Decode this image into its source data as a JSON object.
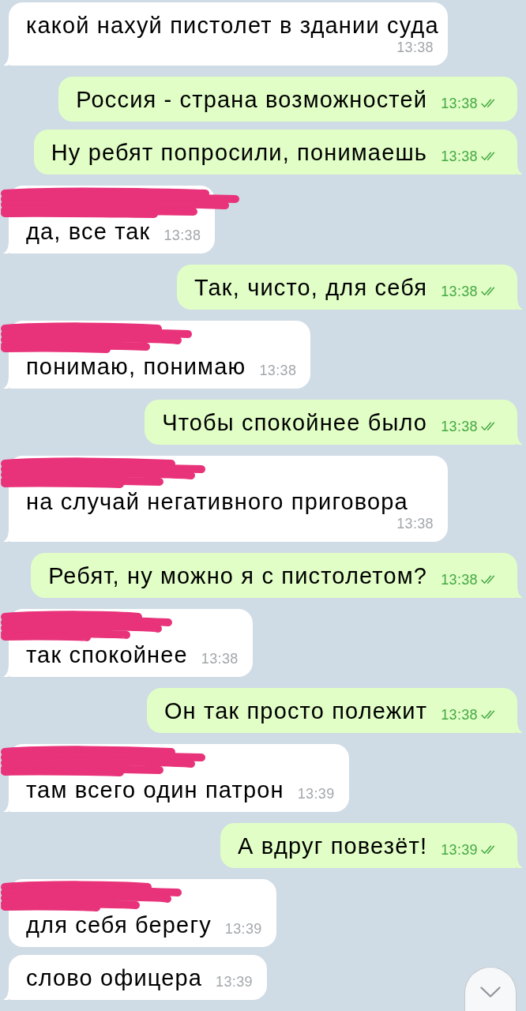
{
  "messages": [
    {
      "kind": "incoming",
      "text": "какой нахуй пистолет в здании суда",
      "time": "13:38",
      "name_redacted": false,
      "read": false,
      "tail": true
    },
    {
      "kind": "outgoing",
      "text": "Россия - страна возможностей",
      "time": "13:38",
      "name_redacted": false,
      "read": true,
      "tail": false
    },
    {
      "kind": "outgoing",
      "text": "Ну ребят попросили, понимаешь",
      "time": "13:38",
      "name_redacted": false,
      "read": true,
      "tail": true
    },
    {
      "kind": "incoming",
      "text": "да, все так",
      "time": "13:38",
      "name_redacted": true,
      "read": false,
      "tail": true
    },
    {
      "kind": "outgoing",
      "text": "Так, чисто, для себя",
      "time": "13:38",
      "name_redacted": false,
      "read": true,
      "tail": true
    },
    {
      "kind": "incoming",
      "text": "понимаю, понимаю",
      "time": "13:38",
      "name_redacted": true,
      "read": false,
      "tail": true
    },
    {
      "kind": "outgoing",
      "text": "Чтобы спокойнее было",
      "time": "13:38",
      "name_redacted": false,
      "read": true,
      "tail": true
    },
    {
      "kind": "incoming",
      "text": "на случай негативного приговора",
      "time": "13:38",
      "name_redacted": true,
      "read": false,
      "tail": true
    },
    {
      "kind": "outgoing",
      "text": "Ребят, ну можно я с пистолетом?",
      "time": "13:38",
      "name_redacted": false,
      "read": true,
      "tail": true
    },
    {
      "kind": "incoming",
      "text": "так спокойнее",
      "time": "13:38",
      "name_redacted": true,
      "read": false,
      "tail": true
    },
    {
      "kind": "outgoing",
      "text": "Он так просто полежит",
      "time": "13:38",
      "name_redacted": false,
      "read": true,
      "tail": true
    },
    {
      "kind": "incoming",
      "text": "там всего один патрон",
      "time": "13:39",
      "name_redacted": true,
      "read": false,
      "tail": true
    },
    {
      "kind": "outgoing",
      "text": "А вдруг повезёт!",
      "time": "13:39",
      "name_redacted": false,
      "read": true,
      "tail": true
    },
    {
      "kind": "incoming",
      "text": "для себя берегу",
      "time": "13:39",
      "name_redacted": true,
      "read": false,
      "tail": false
    },
    {
      "kind": "incoming",
      "text": "слово офицера",
      "time": "13:39",
      "name_redacted": false,
      "read": false,
      "tail": true
    }
  ],
  "scroll_down_button": {
    "shown": true
  }
}
